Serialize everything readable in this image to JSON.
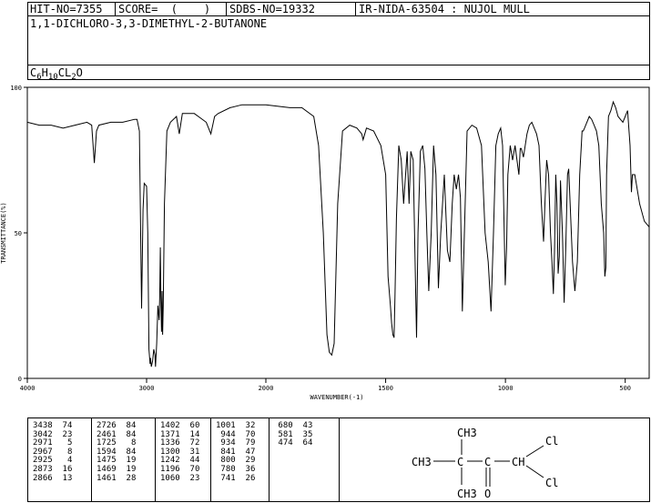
{
  "header": {
    "hit_no": "HIT-NO=7355",
    "score": "SCORE=  (    )",
    "sdbs_no": "SDBS-NO=19332",
    "ir_nida": "IR-NIDA-63504 : NUJOL MULL",
    "compound_name": "1,1-DICHLORO-3,3-DIMETHYL-2-BUTANONE",
    "formula_parts": [
      {
        "t": "C",
        "sub": false
      },
      {
        "t": "6",
        "sub": true
      },
      {
        "t": "H",
        "sub": false
      },
      {
        "t": "10",
        "sub": true
      },
      {
        "t": "CL",
        "sub": false
      },
      {
        "t": "2",
        "sub": true
      },
      {
        "t": "O",
        "sub": false
      }
    ]
  },
  "chart_data": {
    "type": "line",
    "title": "",
    "xlabel": "WAVENUMBER(-1)",
    "ylabel": "TRANSMITTANCE(%)",
    "xlim": [
      4000,
      400
    ],
    "ylim": [
      0,
      100
    ],
    "x_ticks": [
      "4000",
      "3000",
      "2000",
      "1500",
      "1000",
      "500"
    ],
    "x_tick_values": [
      4000,
      3000,
      2000,
      1500,
      1000,
      500
    ],
    "y_ticks": [
      "0",
      "50",
      "100"
    ],
    "y_tick_values": [
      0,
      50,
      100
    ],
    "series": [
      {
        "x": [
          4000,
          3900,
          3800,
          3700,
          3600,
          3500,
          3460,
          3438,
          3420,
          3400,
          3300,
          3200,
          3100,
          3080,
          3060,
          3042,
          3030,
          3020,
          3000,
          2990,
          2980,
          2971,
          2967,
          2960,
          2950,
          2940,
          2930,
          2925,
          2915,
          2905,
          2895,
          2890,
          2885,
          2880,
          2875,
          2870,
          2866,
          2860,
          2850,
          2830,
          2800,
          2750,
          2726,
          2700,
          2600,
          2500,
          2461,
          2430,
          2400,
          2300,
          2200,
          2100,
          2000,
          1900,
          1850,
          1800,
          1780,
          1760,
          1745,
          1735,
          1725,
          1715,
          1700,
          1680,
          1650,
          1620,
          1600,
          1594,
          1580,
          1550,
          1520,
          1500,
          1490,
          1480,
          1475,
          1470,
          1465,
          1461,
          1455,
          1445,
          1435,
          1425,
          1410,
          1402,
          1395,
          1385,
          1375,
          1371,
          1365,
          1355,
          1345,
          1336,
          1328,
          1320,
          1310,
          1300,
          1290,
          1280,
          1270,
          1255,
          1242,
          1232,
          1222,
          1214,
          1205,
          1196,
          1188,
          1180,
          1160,
          1140,
          1120,
          1100,
          1085,
          1072,
          1060,
          1050,
          1040,
          1030,
          1020,
          1012,
          1001,
          995,
          990,
          980,
          970,
          960,
          944,
          938,
          934,
          925,
          910,
          900,
          890,
          880,
          870,
          860,
          850,
          841,
          835,
          828,
          820,
          812,
          806,
          800,
          795,
          790,
          785,
          780,
          775,
          770,
          762,
          755,
          748,
          741,
          736,
          730,
          720,
          710,
          700,
          690,
          682,
          680,
          675,
          670,
          660,
          650,
          640,
          630,
          620,
          610,
          600,
          590,
          585,
          581,
          578,
          570,
          560,
          550,
          540,
          530,
          520,
          510,
          500,
          490,
          480,
          474,
          470,
          460,
          440,
          420,
          400
        ],
        "y": [
          88,
          87,
          87,
          86,
          87,
          88,
          87,
          74,
          85,
          87,
          88,
          88,
          89,
          89,
          85,
          24,
          58,
          67,
          66,
          50,
          10,
          5,
          7,
          4,
          6,
          10,
          8,
          4,
          12,
          25,
          20,
          28,
          45,
          28,
          16,
          30,
          15,
          25,
          60,
          85,
          88,
          90,
          84,
          91,
          91,
          88,
          84,
          90,
          91,
          93,
          94,
          94,
          94,
          93,
          93,
          90,
          80,
          50,
          15,
          9,
          8,
          12,
          60,
          85,
          87,
          86,
          84,
          82,
          86,
          85,
          80,
          70,
          35,
          25,
          19,
          15,
          14,
          28,
          55,
          80,
          75,
          60,
          78,
          60,
          78,
          75,
          30,
          14,
          50,
          78,
          80,
          72,
          50,
          30,
          50,
          80,
          70,
          31,
          50,
          70,
          44,
          40,
          60,
          70,
          65,
          70,
          62,
          23,
          85,
          87,
          86,
          80,
          50,
          40,
          23,
          50,
          80,
          84,
          86,
          80,
          32,
          45,
          70,
          80,
          75,
          80,
          70,
          79,
          79,
          76,
          84,
          87,
          88,
          86,
          84,
          80,
          60,
          47,
          60,
          75,
          70,
          50,
          40,
          29,
          45,
          70,
          60,
          36,
          42,
          68,
          50,
          26,
          45,
          70,
          72,
          60,
          40,
          30,
          40,
          70,
          82,
          85,
          85,
          86,
          88,
          90,
          89,
          87,
          85,
          80,
          60,
          50,
          35,
          38,
          70,
          90,
          92,
          95,
          93,
          90,
          89,
          88,
          90,
          92,
          80,
          64,
          70,
          70,
          60,
          54,
          52
        ]
      }
    ]
  },
  "peak_table": [
    [
      [
        "3438",
        "74"
      ],
      [
        "3042",
        "23"
      ],
      [
        "2971",
        "5"
      ],
      [
        "2967",
        "8"
      ],
      [
        "2925",
        "4"
      ],
      [
        "2873",
        "16"
      ],
      [
        "2866",
        "13"
      ]
    ],
    [
      [
        "2726",
        "84"
      ],
      [
        "2461",
        "84"
      ],
      [
        "1725",
        "8"
      ],
      [
        "1594",
        "84"
      ],
      [
        "1475",
        "19"
      ],
      [
        "1469",
        "19"
      ],
      [
        "1461",
        "28"
      ]
    ],
    [
      [
        "1402",
        "60"
      ],
      [
        "1371",
        "14"
      ],
      [
        "1336",
        "72"
      ],
      [
        "1300",
        "31"
      ],
      [
        "1242",
        "44"
      ],
      [
        "1196",
        "70"
      ],
      [
        "1060",
        "23"
      ]
    ],
    [
      [
        "1001",
        "32"
      ],
      [
        "944",
        "70"
      ],
      [
        "934",
        "79"
      ],
      [
        "841",
        "47"
      ],
      [
        "800",
        "29"
      ],
      [
        "780",
        "36"
      ],
      [
        "741",
        "26"
      ]
    ],
    [
      [
        "680",
        "43"
      ],
      [
        "581",
        "35"
      ],
      [
        "474",
        "64"
      ]
    ]
  ],
  "structure": {
    "top_ch3": "CH3",
    "left_ch3": "CH3",
    "center_c": "C",
    "carbonyl_c": "C",
    "ch": "CH",
    "cl_top": "Cl",
    "cl_bottom": "Cl",
    "bottom_ch3": "CH3",
    "oxygen": "O"
  }
}
